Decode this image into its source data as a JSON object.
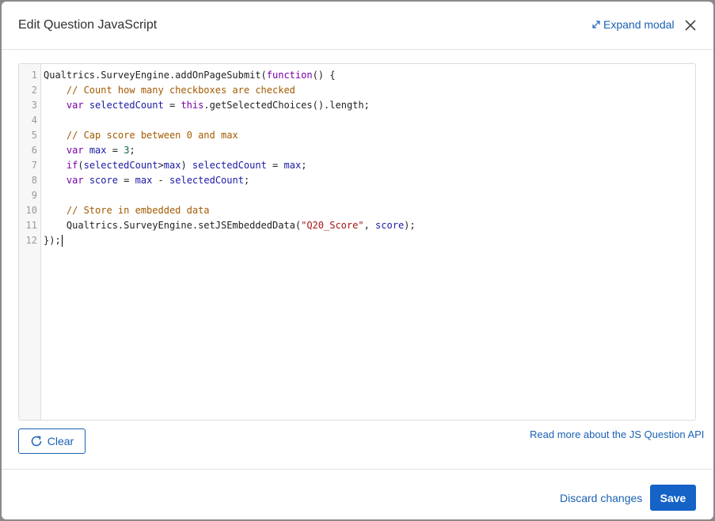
{
  "modal": {
    "title": "Edit Question JavaScript",
    "expand_label": "Expand modal",
    "close_icon": "close-icon",
    "expand_icon": "expand-arrows-icon"
  },
  "editor": {
    "line_numbers": [
      "1",
      "2",
      "3",
      "4",
      "5",
      "6",
      "7",
      "8",
      "9",
      "10",
      "11",
      "12"
    ],
    "lines": {
      "l1": {
        "a": "Qualtrics.SurveyEngine.addOnPageSubmit(",
        "b": "function",
        "c": "() {"
      },
      "l2": {
        "a": "    ",
        "b": "// Count how many checkboxes are checked"
      },
      "l3": {
        "a": "    ",
        "b": "var",
        "c": " ",
        "d": "selectedCount",
        "e": " = ",
        "f": "this",
        "g": ".getSelectedChoices().length;"
      },
      "l4": {},
      "l5": {
        "a": "    ",
        "b": "// Cap score between 0 and max"
      },
      "l6": {
        "a": "    ",
        "b": "var",
        "c": " ",
        "d": "max",
        "e": " = ",
        "f": "3",
        "g": ";"
      },
      "l7": {
        "a": "    ",
        "b": "if",
        "c": "(",
        "d": "selectedCount",
        "e": ">",
        "f": "max",
        "g": ") ",
        "h": "selectedCount",
        "i": " = ",
        "j": "max",
        "k": ";"
      },
      "l8": {
        "a": "    ",
        "b": "var",
        "c": " ",
        "d": "score",
        "e": " = ",
        "f": "max",
        "g": " - ",
        "h": "selectedCount",
        "i": ";"
      },
      "l9": {},
      "l10": {
        "a": "    ",
        "b": "// Store in embedded data"
      },
      "l11": {
        "a": "    Qualtrics.SurveyEngine.setJSEmbeddedData(",
        "b": "\"Q20_Score\"",
        "c": ", ",
        "d": "score",
        "e": ");"
      },
      "l12": {
        "a": "});"
      }
    }
  },
  "actions": {
    "clear_label": "Clear",
    "clear_icon": "refresh-icon",
    "api_link": "Read more about the JS Question API",
    "discard_label": "Discard changes",
    "save_label": "Save"
  },
  "colors": {
    "accent": "#1b62b4",
    "save_bg": "#1563c7",
    "keyword": "#7a00a8",
    "variable": "#1a1aa6",
    "comment": "#a35a00",
    "string": "#a31515",
    "number": "#116644"
  }
}
